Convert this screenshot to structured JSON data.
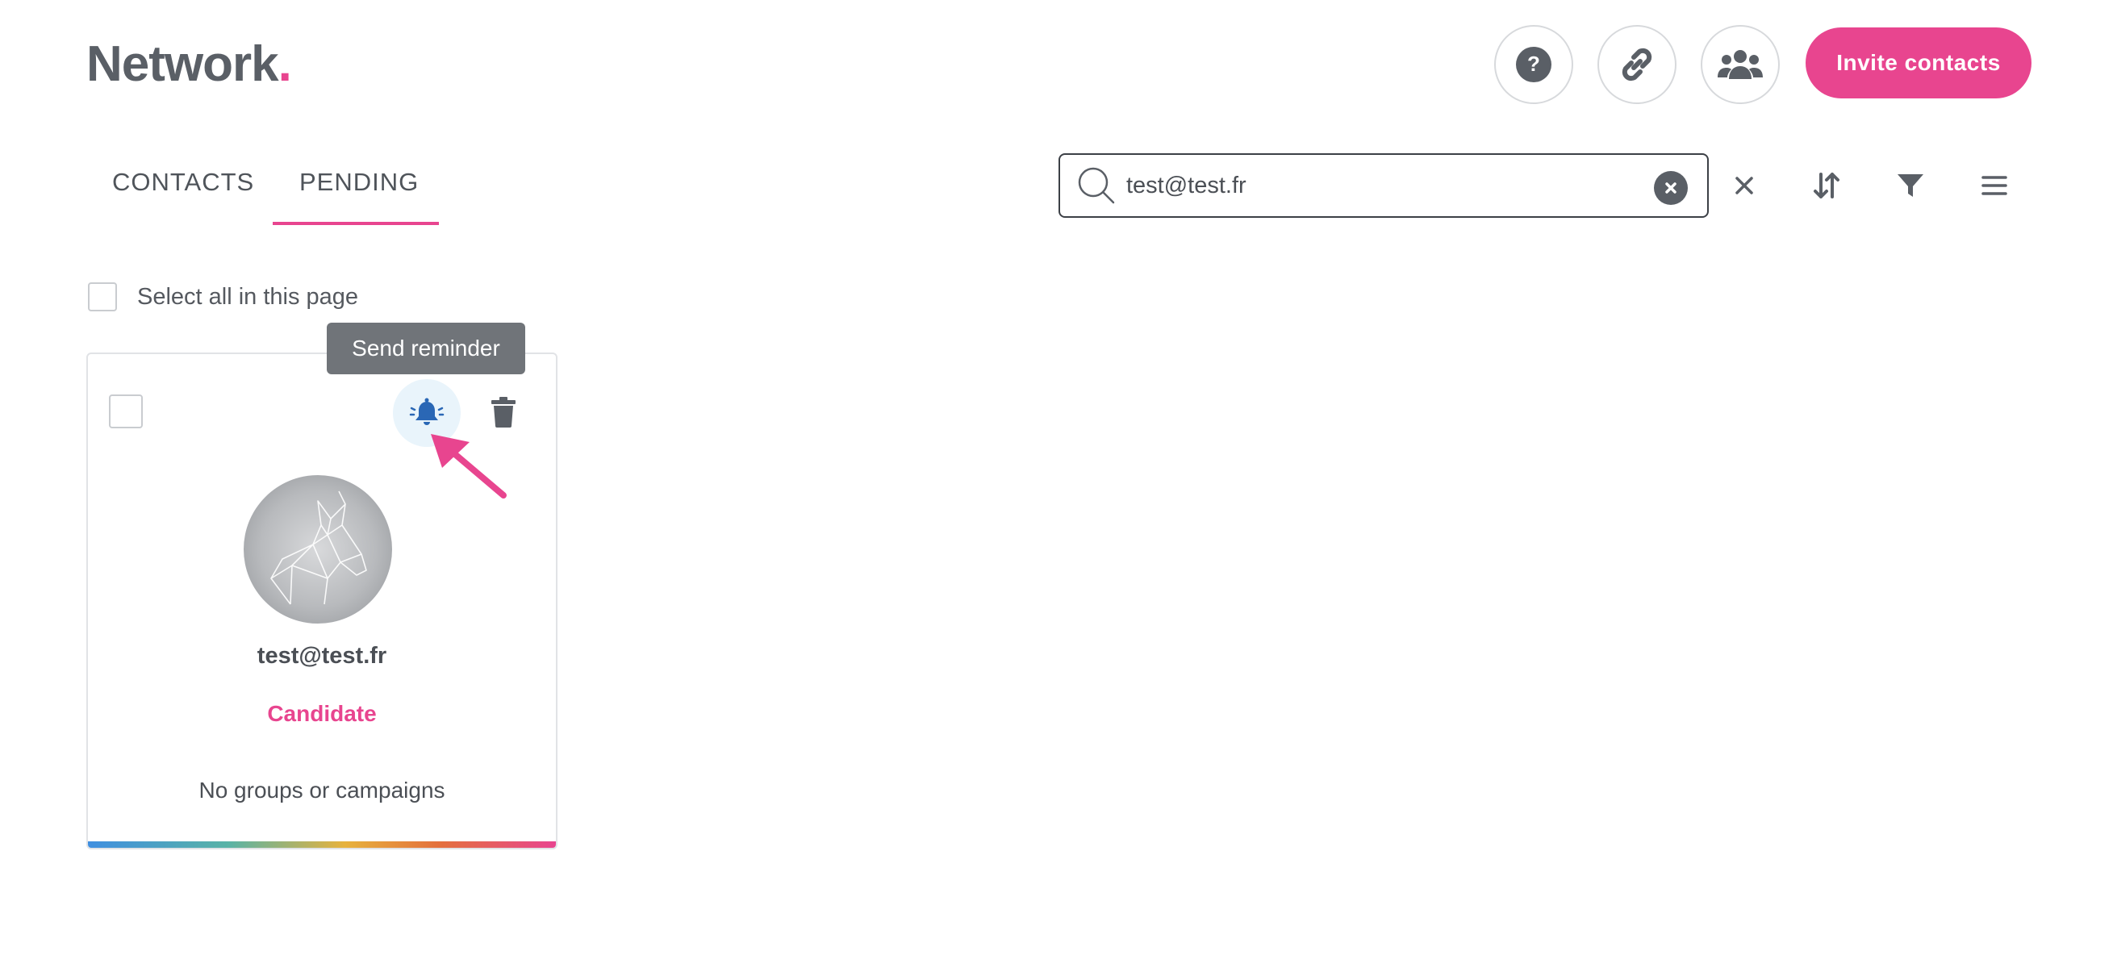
{
  "header": {
    "logo_text": "Network",
    "logo_dot": ".",
    "help_icon": "question-circle-icon",
    "link_icon": "link-icon",
    "people_icon": "users-icon",
    "invite_label": "Invite contacts"
  },
  "tabs": [
    {
      "label": "CONTACTS",
      "active": false
    },
    {
      "label": "PENDING",
      "active": true
    }
  ],
  "search": {
    "value": "test@test.fr",
    "placeholder": ""
  },
  "toolbar": {
    "close_icon": "close-icon",
    "sort_icon": "sort-icon",
    "filter_icon": "filter-icon",
    "menu_icon": "hamburger-menu-icon"
  },
  "select_all": {
    "label": "Select all in this page",
    "checked": false
  },
  "card": {
    "tooltip": "Send reminder",
    "email": "test@test.fr",
    "role": "Candidate",
    "groups": "No groups or campaigns",
    "checked": false
  },
  "colors": {
    "accent": "#e8458f",
    "text": "#4b4f55",
    "tooltip_bg": "#707479",
    "bell_bg": "#e9f4fb",
    "bell_icon": "#2a67b5"
  }
}
